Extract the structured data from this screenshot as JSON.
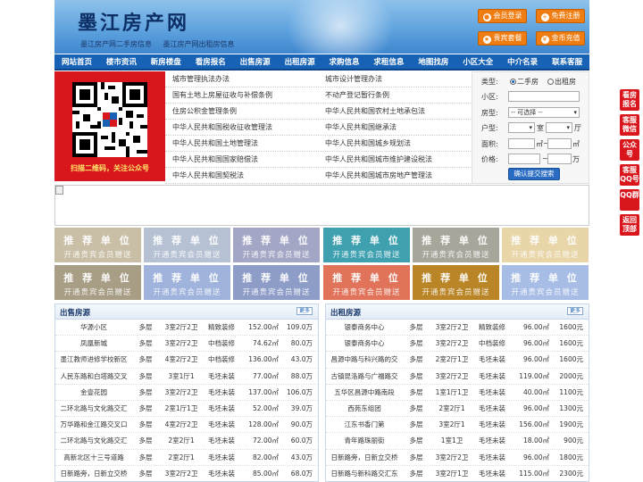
{
  "header": {
    "logo": "墨江房产网",
    "slogans": [
      "墨江房产网二手房信息",
      "墨江房产网出租房信息"
    ],
    "buttons": [
      {
        "label": "会员登录",
        "icon": "user-icon"
      },
      {
        "label": "免费注册",
        "icon": "register-icon"
      },
      {
        "label": "贵宾套餐",
        "icon": "vip-icon"
      },
      {
        "label": "金币充值",
        "icon": "coin-icon"
      }
    ]
  },
  "nav": [
    "网站首页",
    "楼市资讯",
    "新房楼盘",
    "看房报名",
    "出售房源",
    "出租房源",
    "求购信息",
    "求租信息",
    "地图找房",
    "小区大全",
    "中介名录",
    "联系客服"
  ],
  "qr": {
    "caption": "扫描二维码，关注公众号"
  },
  "links": [
    [
      "城市管理执法办法",
      "城市设计管理办法"
    ],
    [
      "国有土地上房屋征收与补偿条例",
      "不动产登记暂行条例"
    ],
    [
      "住房公积金管理条例",
      "中华人民共和国农村土地承包法"
    ],
    [
      "中华人民共和国税收征收管理法",
      "中华人民共和国继承法"
    ],
    [
      "中华人民共和国土地管理法",
      "中华人民共和国城乡规划法"
    ],
    [
      "中华人民共和国国家赔偿法",
      "中华人民共和国城市维护建设税法"
    ],
    [
      "中华人民共和国契税法",
      "中华人民共和国城市房地产管理法"
    ]
  ],
  "search": {
    "type_label": "类型:",
    "type_options": [
      "二手房",
      "出租房"
    ],
    "community_label": "小区:",
    "room_label": "房型:",
    "room_select": "-- 可选择 --",
    "layout_label": "户型:",
    "layout_room": "室",
    "layout_hall": "厅",
    "area_label": "面积:",
    "area_unit": "㎡",
    "range_sep": "~",
    "price_label": "价格:",
    "price_unit": "万",
    "submit": "确认提交搜索"
  },
  "ads": {
    "line1": "推 荐 单 位",
    "line2": "开通贵宾会员赠送",
    "colors": [
      "#c8bfa6",
      "#b6c2d4",
      "#a3a6c4",
      "#3fa0b0",
      "#a8a59a",
      "#e8d5a8",
      "#a89e86",
      "#9fb3dc",
      "#8e9dc8",
      "#e0735a",
      "#b98526",
      "#a8bde6"
    ]
  },
  "sale": {
    "title": "出售房源",
    "more": "更多",
    "rows": [
      [
        "华源小区",
        "多层",
        "3室2厅2卫",
        "精致装修",
        "152.00㎡",
        "109.0万"
      ],
      [
        "凤凰新城",
        "多层",
        "3室2厅2卫",
        "中档装修",
        "74.62㎡",
        "80.0万"
      ],
      [
        "墨江教师进修学校新区",
        "多层",
        "4室2厅2卫",
        "中档装修",
        "136.00㎡",
        "43.0万"
      ],
      [
        "人民东路和白塔路交叉",
        "多层",
        "3室1厅1",
        "毛坯未装",
        "77.00㎡",
        "88.0万"
      ],
      [
        "金壹花园",
        "多层",
        "3室2厅2卫",
        "毛坯未装",
        "137.00㎡",
        "106.0万"
      ],
      [
        "二环北路与文化路交汇",
        "多层",
        "2室1厅1卫",
        "毛坯未装",
        "52.00㎡",
        "39.0万"
      ],
      [
        "万华路和金江路交叉口",
        "多层",
        "4室2厅2卫",
        "毛坯未装",
        "128.00㎡",
        "90.0万"
      ],
      [
        "二环北路与文化路交汇",
        "多层",
        "2室2厅1",
        "毛坯未装",
        "72.00㎡",
        "60.0万"
      ],
      [
        "高新北区十三号道路",
        "多层",
        "2室2厅1",
        "毛坯未装",
        "82.00㎡",
        "43.0万"
      ],
      [
        "日新路旁，日新立交桥",
        "多层",
        "3室2厅2卫",
        "毛坯未装",
        "85.00㎡",
        "68.0万"
      ]
    ]
  },
  "rent": {
    "title": "出租房源",
    "more": "更多",
    "rows": [
      [
        "银泰商务中心",
        "多层",
        "3室2厅2卫",
        "精致装修",
        "96.00㎡",
        "1600元"
      ],
      [
        "银泰商务中心",
        "多层",
        "3室2厅2卫",
        "中档装修",
        "96.00㎡",
        "1600元"
      ],
      [
        "昌源中路与科兴路的交",
        "多层",
        "2室2厅1卫",
        "毛坯未装",
        "96.00㎡",
        "1600元"
      ],
      [
        "古镇昆洛路与广福路交",
        "多层",
        "3室2厅2卫",
        "毛坯未装",
        "119.00㎡",
        "2000元"
      ],
      [
        "五华区昌源中路南段",
        "多层",
        "1室1厅1卫",
        "毛坯未装",
        "40.00㎡",
        "1100元"
      ],
      [
        "西苑东组团",
        "多层",
        "2室2厅1",
        "毛坯未装",
        "96.00㎡",
        "1300元"
      ],
      [
        "江东书香门第",
        "多层",
        "3室2厅1",
        "毛坯未装",
        "156.00㎡",
        "1900元"
      ],
      [
        "青年路珠丽街",
        "多层",
        "1室1卫",
        "毛坯未装",
        "18.00㎡",
        "900元"
      ],
      [
        "日新路旁，日新立交桥",
        "多层",
        "3室2厅2卫",
        "毛坯未装",
        "96.00㎡",
        "1800元"
      ],
      [
        "日新路与新科路交汇东",
        "多层",
        "3室2厅1卫",
        "毛坯未装",
        "115.00㎡",
        "2300元"
      ]
    ]
  },
  "float": [
    {
      "label": "看房报名",
      "color": "#d9161c"
    },
    {
      "label": "客服微信",
      "color": "#d9161c"
    },
    {
      "label": "公众号",
      "color": "#d9161c"
    },
    {
      "label": "客服QQ号",
      "color": "#d9161c"
    },
    {
      "label": "QQ群",
      "color": "#d9161c"
    },
    {
      "label": "返回顶部",
      "color": "#d9161c"
    }
  ]
}
